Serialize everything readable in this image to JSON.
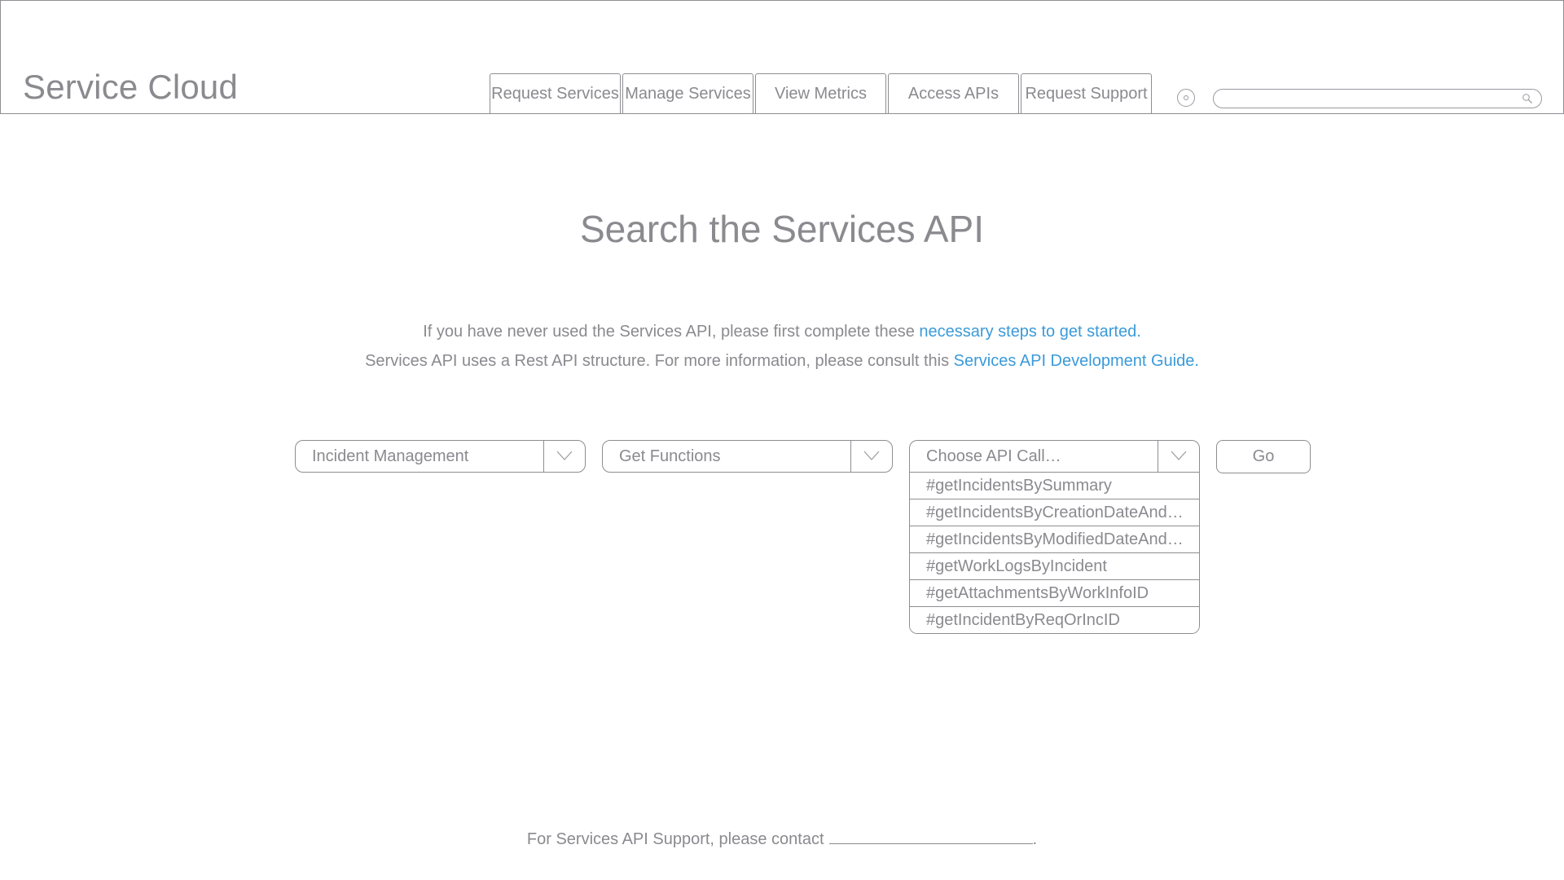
{
  "header": {
    "brand": "Service Cloud",
    "nav": [
      {
        "label": "Request Services"
      },
      {
        "label": "Manage Services"
      },
      {
        "label": "View Metrics"
      },
      {
        "label": "Access APIs"
      },
      {
        "label": "Request Support"
      }
    ],
    "search": {
      "value": "",
      "placeholder": ""
    },
    "icons": {
      "settings": "settings-icon",
      "search": "search-icon"
    }
  },
  "main": {
    "title": "Search the Services API",
    "info_1": {
      "text": "If you have never used the Services API, please first complete these ",
      "link": "necessary steps to get started."
    },
    "info_2": {
      "text": "Services API uses a Rest API structure. For more information, please consult this ",
      "link": "Services API Development Guide."
    },
    "dropdowns": [
      {
        "value": "Incident Management"
      },
      {
        "value": "Get Functions"
      },
      {
        "value": "Choose API Call…"
      }
    ],
    "options": [
      "#getIncidentsBySummary",
      "#getIncidentsByCreationDateAnd…",
      "#getIncidentsByModifiedDateAnd…",
      "#getWorkLogsByIncident",
      "#getAttachmentsByWorkInfoID",
      "#getIncidentByReqOrIncID"
    ],
    "go_label": "Go"
  },
  "footer": {
    "text": "For Services API Support, please contact",
    "end": "."
  },
  "colors": {
    "text": "#8a8a8f",
    "link": "#3a9ad9",
    "border": "#8e8e93"
  }
}
